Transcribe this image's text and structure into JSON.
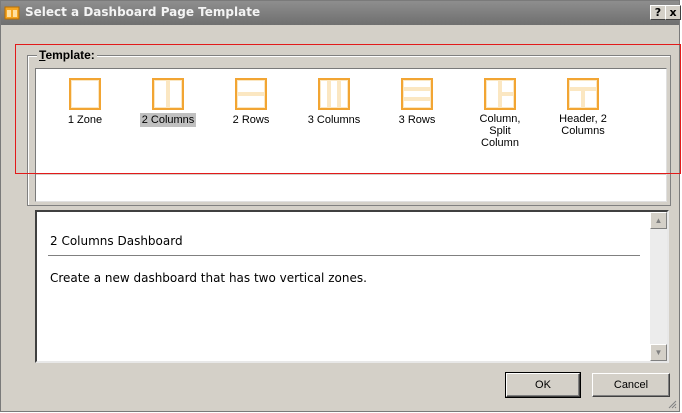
{
  "window": {
    "title": "Select a Dashboard Page Template",
    "help_label": "?",
    "close_label": "x"
  },
  "template_group": {
    "label_mnemonic": "T",
    "label_rest": "emplate:",
    "selected": "2 Columns",
    "items": [
      {
        "name": "1 Zone",
        "icon": "one-zone-layout-icon"
      },
      {
        "name": "2 Columns",
        "icon": "two-columns-layout-icon"
      },
      {
        "name": "2 Rows",
        "icon": "two-rows-layout-icon"
      },
      {
        "name": "3 Columns",
        "icon": "three-columns-layout-icon"
      },
      {
        "name": "3 Rows",
        "icon": "three-rows-layout-icon"
      },
      {
        "name": "Column, Split Column",
        "icon": "column-split-column-layout-icon"
      },
      {
        "name": "Header, 2 Columns",
        "icon": "header-two-columns-layout-icon"
      }
    ]
  },
  "description": {
    "title": "2 Columns Dashboard",
    "text": "Create a new dashboard that has two vertical zones."
  },
  "buttons": {
    "ok": "OK",
    "cancel": "Cancel"
  },
  "colors": {
    "dialog_bg": "#d4d0c8",
    "titlebar": "#7f7f7f",
    "icon_outline": "#f2a533",
    "icon_fill": "#fbe7c2",
    "annotation_box": "#e21a1a"
  }
}
